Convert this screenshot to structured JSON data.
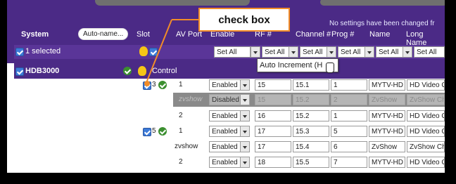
{
  "header": {
    "status": "No settings have been changed fr",
    "auto_name": "Auto-name...",
    "columns": [
      "System",
      "Slot",
      "AV Port",
      "Enable",
      "RF #",
      "Channel #",
      "Prog #",
      "Name",
      "Long Name"
    ]
  },
  "selection": {
    "label": "1 selected",
    "set_all": "Set All"
  },
  "device": {
    "name": "HDB3000",
    "control": "Control"
  },
  "slots": [
    {
      "slot": "3"
    },
    {
      "slot": "5"
    }
  ],
  "rows": [
    {
      "port": "1",
      "enable": "Enabled",
      "rf": "15",
      "channel": "15.1",
      "prog": "1",
      "name": "MYTV-HD",
      "long_name": "HD Video Ch"
    },
    {
      "port": "zvshow",
      "enable": "Disabled",
      "rf": "15",
      "channel": "15.2",
      "prog": "2",
      "name": "ZvShow",
      "long_name": "ZvShow Ch"
    },
    {
      "port": "2",
      "enable": "Enabled",
      "rf": "16",
      "channel": "15.2",
      "prog": "1",
      "name": "MYTV-HD",
      "long_name": "HD Video Ch"
    },
    {
      "port": "1",
      "enable": "Enabled",
      "rf": "17",
      "channel": "15.3",
      "prog": "5",
      "name": "MYTV-HD",
      "long_name": "HD Video Ch"
    },
    {
      "port": "zvshow",
      "enable": "Enabled",
      "rf": "17",
      "channel": "15.4",
      "prog": "6",
      "name": "ZvShow",
      "long_name": "ZvShow Ch"
    },
    {
      "port": "2",
      "enable": "Enabled",
      "rf": "18",
      "channel": "15.5",
      "prog": "7",
      "name": "MYTV-HD",
      "long_name": "HD Video Ch"
    }
  ],
  "tooltip": {
    "text": "Auto Increment (H"
  },
  "annotation": {
    "text": "check box"
  },
  "colors": {
    "header_purple": "#4b2a86",
    "callout_orange": "#f28c28",
    "checkbox_blue": "#3d7bd9",
    "status_green": "#3b8f2f",
    "bulb_yellow": "#f5c516"
  }
}
